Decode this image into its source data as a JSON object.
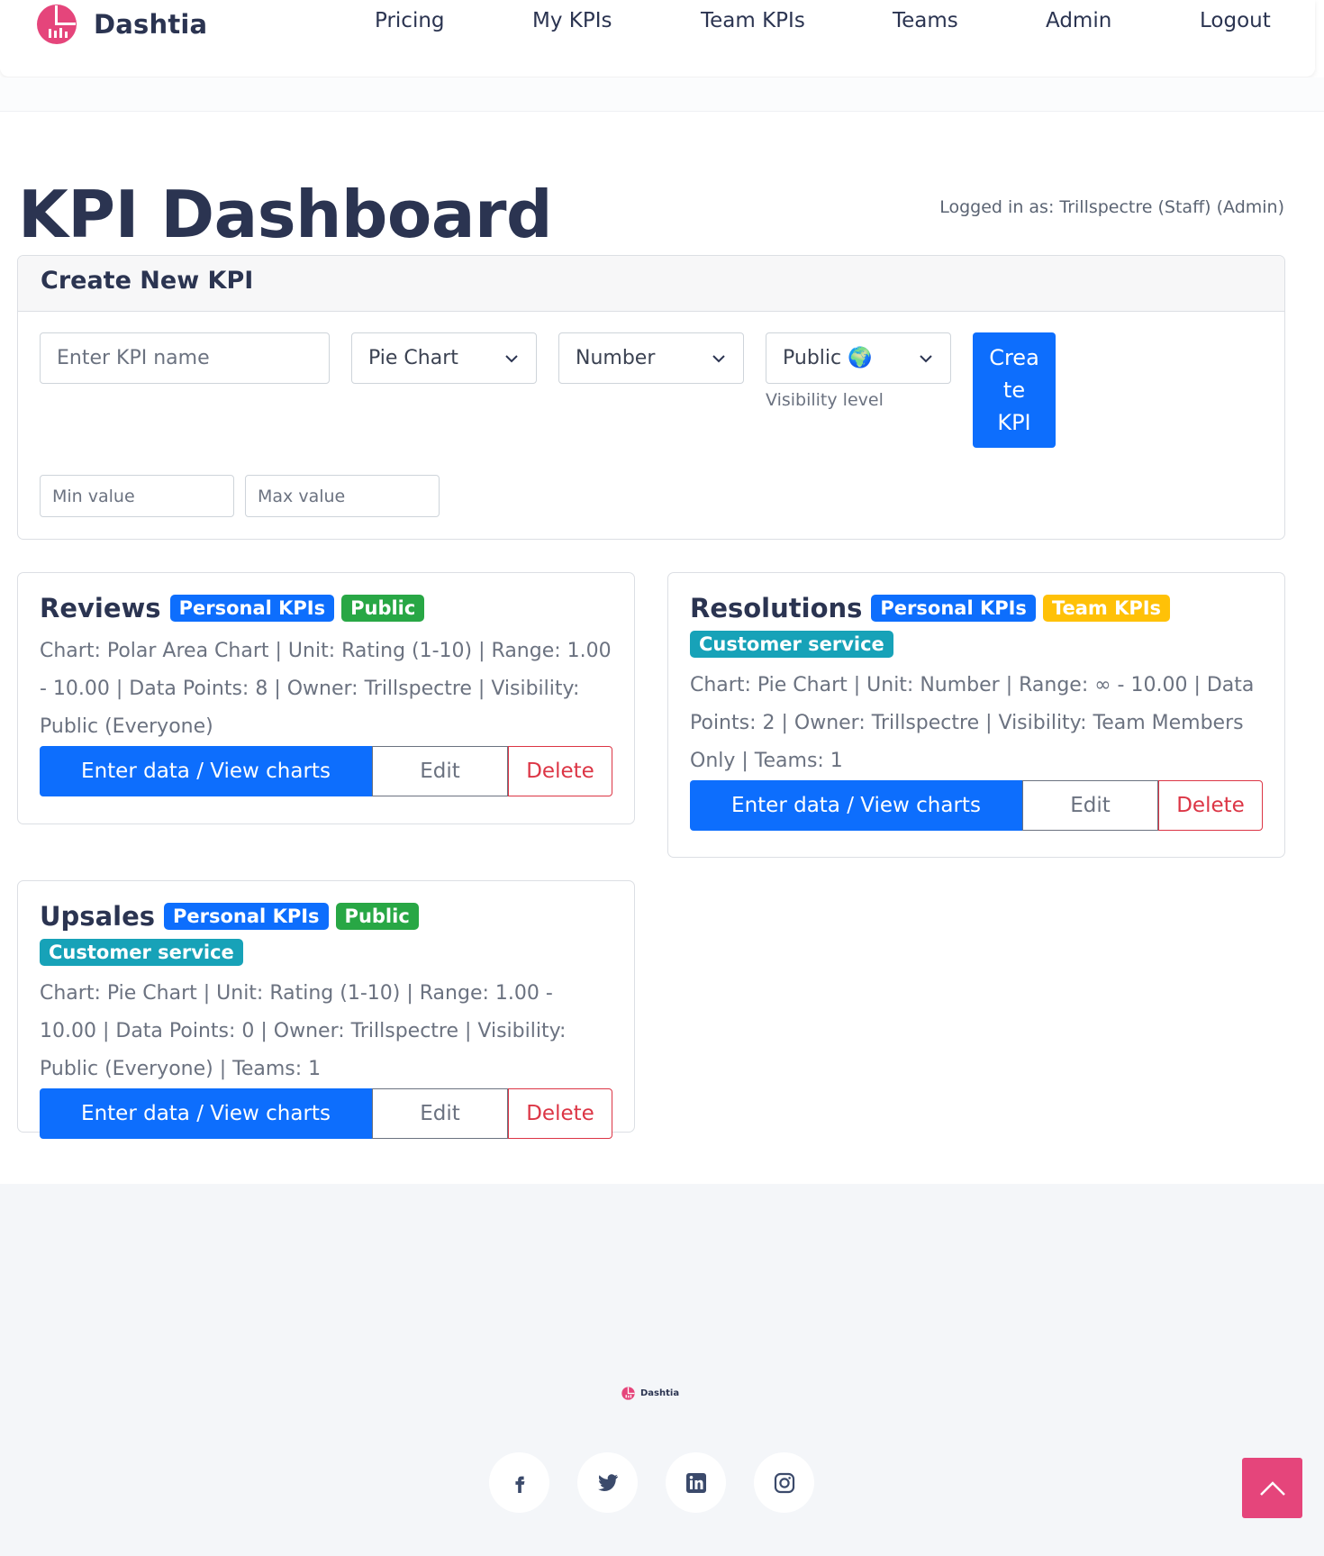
{
  "brand": {
    "name": "Dashtia",
    "accent_color": "#e5457b"
  },
  "nav": {
    "items": [
      {
        "label": "Pricing"
      },
      {
        "label": "My KPIs"
      },
      {
        "label": "Team KPIs"
      },
      {
        "label": "Teams"
      },
      {
        "label": "Admin"
      },
      {
        "label": "Logout"
      }
    ]
  },
  "header": {
    "title": "KPI Dashboard",
    "logged_in": "Logged in as: Trillspectre (Staff) (Admin)"
  },
  "create_form": {
    "title": "Create New KPI",
    "name_placeholder": "Enter KPI name",
    "chart_type": "Pie Chart",
    "unit": "Number",
    "visibility": "Public 🌍",
    "visibility_help": "Visibility level",
    "submit_line1": "Crea",
    "submit_line2": "te",
    "submit_line3": "KPI",
    "min_placeholder": "Min value",
    "max_placeholder": "Max value"
  },
  "kpis": [
    {
      "title": "Reviews",
      "badges": [
        {
          "label": "Personal KPIs",
          "color": "#0d6efd"
        },
        {
          "label": "Public",
          "color": "#28a745"
        }
      ],
      "description": "Chart: Polar Area Chart | Unit: Rating (1-10) | Range: 1.00 - 10.00 | Data Points: 8 | Owner: Trillspectre | Visibility: Public (Everyone)",
      "primary_label": "Enter data / View charts",
      "edit_label": "Edit",
      "delete_label": "Delete"
    },
    {
      "title": "Resolutions",
      "badges": [
        {
          "label": "Personal KPIs",
          "color": "#0d6efd"
        },
        {
          "label": "Team KPIs",
          "color": "#ffc107"
        },
        {
          "label": "Customer service",
          "color": "#17a2b8"
        }
      ],
      "description": "Chart: Pie Chart | Unit: Number | Range: ∞ - 10.00 | Data Points: 2 | Owner: Trillspectre | Visibility: Team Members Only | Teams: 1",
      "primary_label": "Enter data / View charts",
      "edit_label": "Edit",
      "delete_label": "Delete"
    },
    {
      "title": "Upsales",
      "badges": [
        {
          "label": "Personal KPIs",
          "color": "#0d6efd"
        },
        {
          "label": "Public",
          "color": "#28a745"
        },
        {
          "label": "Customer service",
          "color": "#17a2b8"
        }
      ],
      "description": "Chart: Pie Chart | Unit: Rating (1-10) | Range: 1.00 - 10.00 | Data Points: 0 | Owner: Trillspectre | Visibility: Public (Everyone) | Teams: 1",
      "primary_label": "Enter data / View charts",
      "edit_label": "Edit",
      "delete_label": "Delete"
    }
  ],
  "footer": {
    "brand_name": "Dashtia",
    "social": [
      "facebook-icon",
      "twitter-icon",
      "linkedin-icon",
      "instagram-icon"
    ]
  }
}
